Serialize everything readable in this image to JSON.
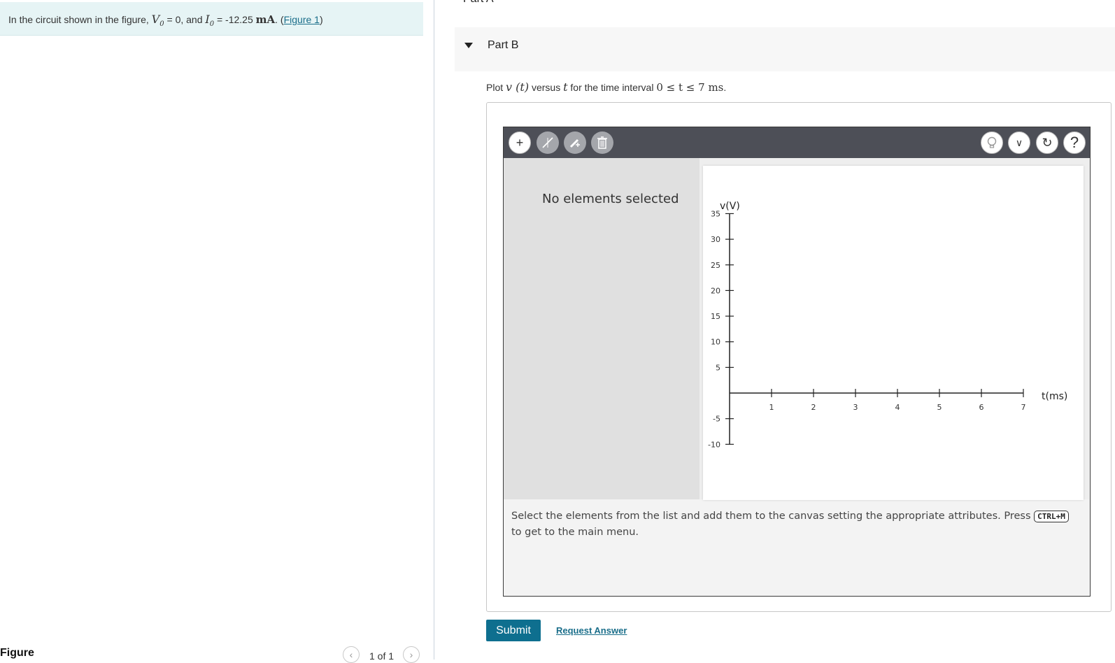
{
  "problem": {
    "intro": "In the circuit shown in the figure,",
    "v_symbol": "V",
    "v_sub": "0",
    "v_value": "= 0, and",
    "i_symbol": "I",
    "i_sub": "0",
    "i_value": "= -12.25",
    "i_unit": "mA",
    "after_unit": ". (",
    "figure_link": "Figure 1",
    "close_paren": ")"
  },
  "figure_panel": {
    "label": "Figure",
    "prev_icon": "chevron-left-icon",
    "next_icon": "chevron-right-icon",
    "pager": "1 of 1"
  },
  "part_a": {
    "title_fragment": "Part A"
  },
  "part_b": {
    "title": "Part B",
    "prompt_plot": "Plot",
    "prompt_func": "v (t)",
    "prompt_versus": "versus",
    "prompt_var": "t",
    "prompt_interval": "for the time interval",
    "prompt_range": "0 ≤ t ≤ 7 ms",
    "prompt_end": "."
  },
  "toolbar": {
    "left_tools": [
      {
        "name": "add-element-icon",
        "glyph": "+"
      },
      {
        "name": "line-tool-icon",
        "glyph": "⟋"
      },
      {
        "name": "pencil-add-icon",
        "glyph": "✎"
      },
      {
        "name": "trash-icon",
        "glyph": "🗑"
      }
    ],
    "right_tools": [
      {
        "name": "lightbulb-icon",
        "glyph": "💡"
      },
      {
        "name": "chevron-down-icon",
        "glyph": "⌄"
      },
      {
        "name": "reset-icon",
        "glyph": "↻"
      },
      {
        "name": "help-icon",
        "glyph": "?"
      }
    ]
  },
  "side_panel": {
    "status": "No elements selected"
  },
  "graph": {
    "y_label": "v(V)",
    "x_label": "t(ms)",
    "y_ticks": [
      "35",
      "30",
      "25",
      "20",
      "15",
      "10",
      "5",
      "-5",
      "-10"
    ],
    "x_ticks": [
      "1",
      "2",
      "3",
      "4",
      "5",
      "6",
      "7"
    ]
  },
  "instructions": {
    "before_key": "Select the elements from the list and add them to the canvas setting the appropriate attributes. Press",
    "key": "CTRL+M",
    "after_key": "to get to the main menu."
  },
  "actions": {
    "submit": "Submit",
    "request_answer": "Request Answer"
  }
}
